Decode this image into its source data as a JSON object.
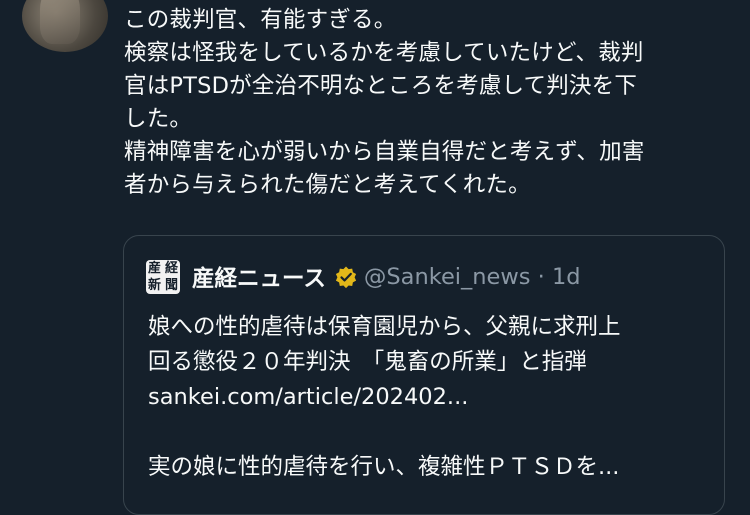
{
  "tweet": {
    "lines": [
      "この裁判官、有能すぎる。",
      "検察は怪我をしているかを考慮していたけど、裁判",
      "官はPTSDが全治不明なところを考慮して判決を下",
      "した。",
      "精神障害を心が弱いから自業自得だと考えず、加害",
      "者から与えられた傷だと考えてくれた。"
    ]
  },
  "quote": {
    "logo_chars": [
      "産",
      "経",
      "新",
      "聞"
    ],
    "name": "産経ニュース",
    "handle": "@Sankei_news · 1d",
    "lines": [
      "娘への性的虐待は保育園児から、父親に求刑上",
      "回る懲役２０年判決　「鬼畜の所業」と指弾",
      "sankei.com/article/202402...",
      "",
      "実の娘に性的虐待を行い、複雑性ＰＴＳＤを..."
    ]
  },
  "colors": {
    "background": "#15202b",
    "text": "#f7f9f9",
    "muted": "#8b98a5",
    "border": "#38444d",
    "verified_gold": "#e2b719"
  }
}
